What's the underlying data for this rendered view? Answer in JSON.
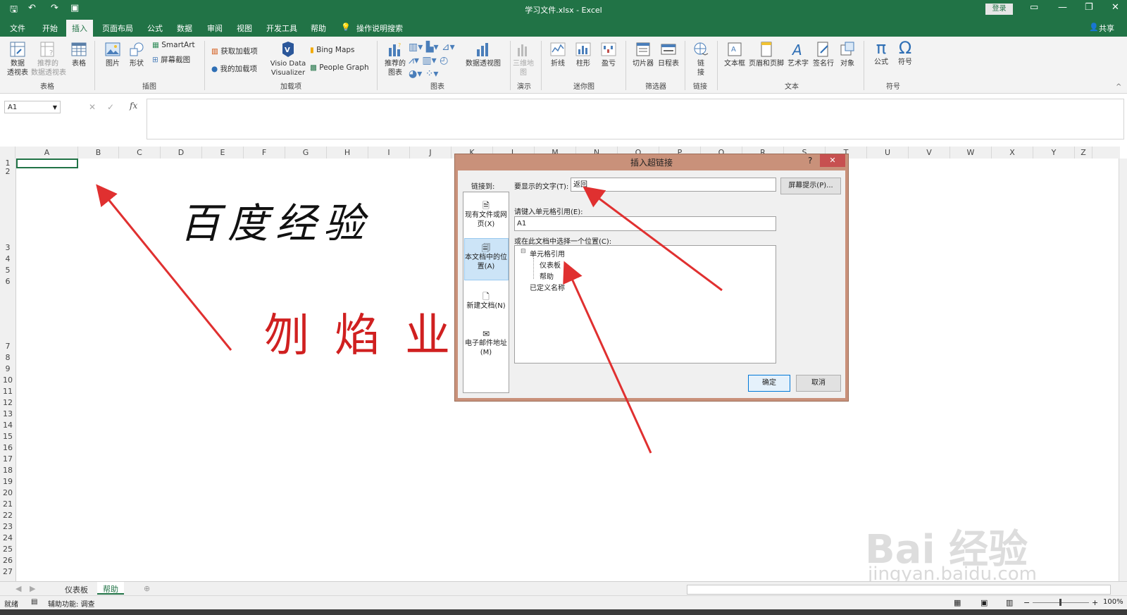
{
  "window": {
    "title": "学习文件.xlsx  -  Excel",
    "login": "登录"
  },
  "tabs": [
    "文件",
    "开始",
    "插入",
    "页面布局",
    "公式",
    "数据",
    "审阅",
    "视图",
    "开发工具",
    "帮助"
  ],
  "tell_me": "操作说明搜索",
  "share": "共享",
  "ribbon": {
    "buttons": {
      "pivot": "数据\n透视表",
      "rec_pivot": "推荐的\n数据透视表",
      "table": "表格",
      "picture": "图片",
      "shapes": "形状",
      "smartart": "SmartArt",
      "screenshot": "屏幕截图",
      "get_addins": "获取加载项",
      "my_addins": "我的加载项",
      "visio": "Visio Data\nVisualizer",
      "bing": "Bing Maps",
      "people": "People Graph",
      "rec_charts": "推荐的\n图表",
      "pivotchart": "数据透视图",
      "map3d": "三维地\n图",
      "line": "折线",
      "column": "柱形",
      "winloss": "盈亏",
      "slicer": "切片器",
      "timeline": "日程表",
      "link": "链\n接",
      "textbox": "文本框",
      "headerfooter": "页眉和页脚",
      "wordart": "艺术字",
      "signature": "签名行",
      "object": "对象",
      "equation": "公式",
      "symbol": "符号"
    },
    "groups": [
      "表格",
      "插图",
      "加载项",
      "图表",
      "演示",
      "迷你图",
      "筛选器",
      "链接",
      "文本",
      "符号"
    ]
  },
  "formula_bar": {
    "namebox": "A1",
    "fx": "fx"
  },
  "columns": [
    "A",
    "B",
    "C",
    "D",
    "E",
    "F",
    "G",
    "H",
    "I",
    "J",
    "K",
    "L",
    "M",
    "N",
    "O",
    "P",
    "Q",
    "R",
    "S",
    "T",
    "U",
    "V",
    "W",
    "X",
    "Y",
    "Z"
  ],
  "rows": [
    "1",
    "2",
    "3",
    "4",
    "5",
    "6",
    "7",
    "8",
    "9",
    "10",
    "11",
    "12",
    "13",
    "14",
    "15",
    "16",
    "17",
    "18",
    "19",
    "20",
    "21",
    "22",
    "23",
    "24",
    "25",
    "26",
    "27"
  ],
  "sheet_content": {
    "heading": "百度经验",
    "seal_text": "刎焰业章"
  },
  "dialog": {
    "title": "插入超链接",
    "help": "?",
    "close": "✕",
    "link_to_label": "链接到:",
    "nav": [
      "现有文件或网页(X)",
      "本文档中的位置(A)",
      "新建文档(N)",
      "电子邮件地址(M)"
    ],
    "display_text_label": "要显示的文字(T):",
    "display_text_value": "返回",
    "screentip_button": "屏幕提示(P)...",
    "cell_ref_label": "请键入单元格引用(E):",
    "cell_ref_value": "A1",
    "location_label": "或在此文档中选择一个位置(C):",
    "tree": [
      "单元格引用",
      "仪表板",
      "帮助",
      "已定义名称"
    ],
    "ok": "确定",
    "cancel": "取消"
  },
  "sheets": [
    "仪表板",
    "帮助"
  ],
  "status": {
    "ready": "就绪",
    "accessibility": "辅助功能: 调查",
    "zoom": "100%"
  },
  "watermark": {
    "line1": "Bai 经验",
    "line2": "jingyan.baidu.com"
  },
  "colors": {
    "excel_green": "#217346",
    "arrow_red": "#e03030",
    "dialog_frame": "#c9917a"
  }
}
